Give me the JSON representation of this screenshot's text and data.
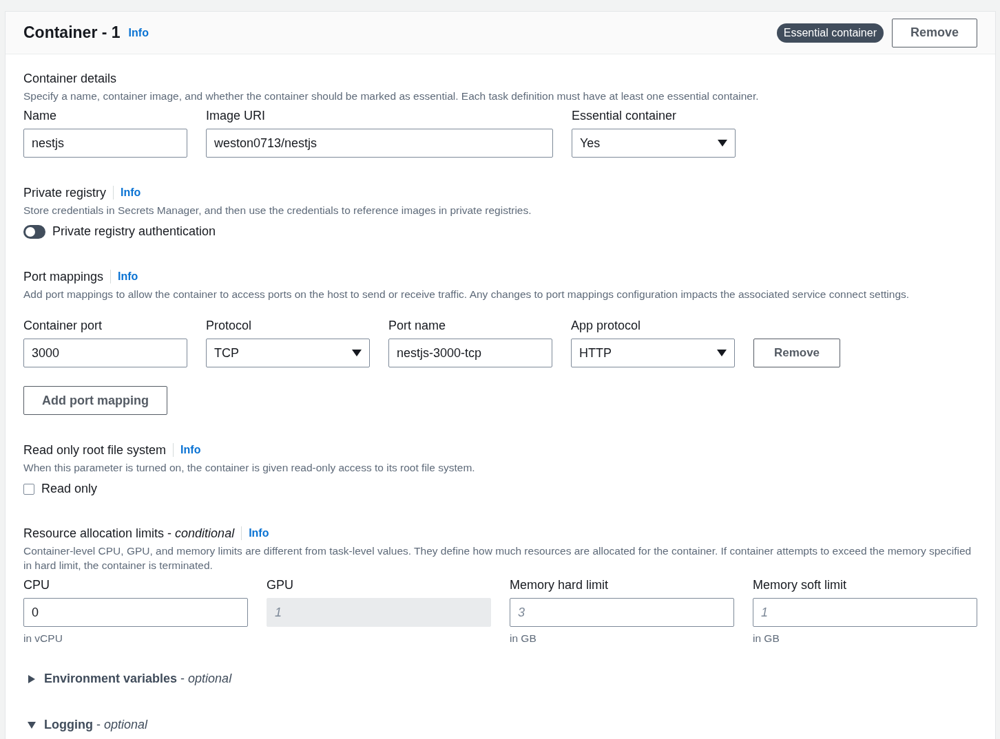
{
  "header": {
    "title": "Container - 1",
    "info": "Info",
    "badge": "Essential container",
    "remove": "Remove"
  },
  "details": {
    "title": "Container details",
    "description": "Specify a name, container image, and whether the container should be marked as essential. Each task definition must have at least one essential container.",
    "fields": [
      {
        "kind": "input",
        "label": "Name",
        "value": "nestjs"
      },
      {
        "kind": "input",
        "label": "Image URI",
        "value": "weston0713/nestjs"
      },
      {
        "kind": "select",
        "label": "Essential container",
        "value": "Yes"
      }
    ]
  },
  "private_registry": {
    "title": "Private registry",
    "info": "Info",
    "description": "Store credentials in Secrets Manager, and then use the credentials to reference images in private registries.",
    "toggle": {
      "label": "Private registry authentication",
      "on": false
    }
  },
  "port_mappings": {
    "title": "Port mappings",
    "info": "Info",
    "description": "Add port mappings to allow the container to access ports on the host to send or receive traffic. Any changes to port mappings configuration impacts the associated service connect settings.",
    "fields": [
      {
        "kind": "input",
        "label": "Container port",
        "value": "3000"
      },
      {
        "kind": "select",
        "label": "Protocol",
        "value": "TCP"
      },
      {
        "kind": "input",
        "label": "Port name",
        "value": "nestjs-3000-tcp"
      },
      {
        "kind": "select",
        "label": "App protocol",
        "value": "HTTP"
      }
    ],
    "remove": "Remove",
    "add": "Add port mapping"
  },
  "read_only": {
    "title": "Read only root file system",
    "info": "Info",
    "description": "When this parameter is turned on, the container is given read-only access to its root file system.",
    "checkbox": {
      "label": "Read only",
      "checked": false
    }
  },
  "resources": {
    "title": "Resource allocation limits - *conditional*",
    "info": "Info",
    "description": "Container-level CPU, GPU, and memory limits are different from task-level values. They define how much resources are allocated for the container. If container attempts to exceed the memory specified in hard limit, the container is terminated.",
    "fields": [
      {
        "label": "CPU",
        "value": "0",
        "hint": "in vCPU",
        "disabled": false
      },
      {
        "label": "GPU",
        "placeholder": "1",
        "disabled": true
      },
      {
        "label": "Memory hard limit",
        "placeholder": "3",
        "hint": "in GB",
        "disabled": false
      },
      {
        "label": "Memory soft limit",
        "placeholder": "1",
        "hint": "in GB",
        "disabled": false
      }
    ]
  },
  "sections": [
    {
      "title": "**Environment variables** - *optional*",
      "expanded": false
    },
    {
      "title": "**Logging** - *optional*",
      "expanded": true
    }
  ]
}
